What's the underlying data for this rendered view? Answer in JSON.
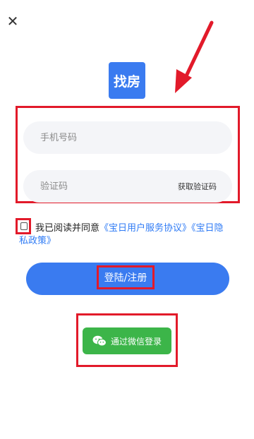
{
  "header": {
    "close_icon": "close-icon",
    "logo_text": "找房"
  },
  "form": {
    "phone_placeholder": "手机号码",
    "code_placeholder": "验证码",
    "get_code_label": "获取验证码"
  },
  "agreement": {
    "prefix": "我已阅读并同意",
    "link1": "《宝日用户服务协议》",
    "link2_part1": "《宝日隐",
    "link2_part2": "私政策》",
    "checked": false
  },
  "actions": {
    "login_label": "登陆/注册",
    "wechat_label": "通过微信登录"
  },
  "colors": {
    "primary": "#3a7bf0",
    "link": "#2f7bf5",
    "wechat_green": "#3cb549",
    "annotation_red": "#e21a2a"
  }
}
